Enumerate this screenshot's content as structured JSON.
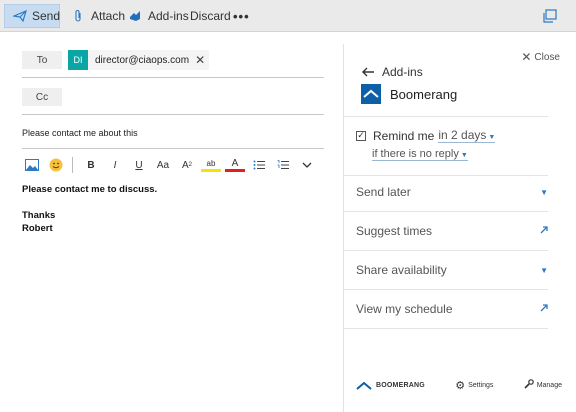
{
  "toolbar": {
    "send": "Send",
    "attach": "Attach",
    "addins": "Add-ins",
    "discard": "Discard",
    "more": "•••"
  },
  "compose": {
    "to_label": "To",
    "cc_label": "Cc",
    "recipient": {
      "initials": "DI",
      "email": "director@ciaops.com"
    },
    "subject": "Please contact me about this",
    "body_lines": [
      "Please contact me to discuss.",
      "",
      "Thanks",
      "Robert"
    ]
  },
  "format_bar": {
    "bold": "B",
    "italic": "I",
    "underline": "U",
    "font_size": "Aa",
    "superscript": "A",
    "superscript_mark": "2",
    "highlight": "ab",
    "font_color": "A"
  },
  "panel": {
    "close": "Close",
    "back_label": "Add-ins",
    "brand": "Boomerang",
    "remind_label": "Remind me",
    "remind_when": "in 2 days",
    "remind_condition": "if there is no reply",
    "items": [
      {
        "label": "Send later",
        "indicator": "dropdown"
      },
      {
        "label": "Suggest times",
        "indicator": "external"
      },
      {
        "label": "Share availability",
        "indicator": "dropdown"
      },
      {
        "label": "View my schedule",
        "indicator": "external"
      }
    ],
    "footer": {
      "brand": "BOOMERANG",
      "settings": "Settings",
      "manage": "Manage"
    }
  },
  "colors": {
    "accent": "#2b79c2",
    "brand_blue": "#0d5fa8",
    "avatar_teal": "#0aa5a5",
    "send_bg": "#c7dcf0",
    "toolbar_bg": "#eaeaea",
    "font_color_red": "#e02020",
    "highlight_yellow": "#f2e600"
  }
}
